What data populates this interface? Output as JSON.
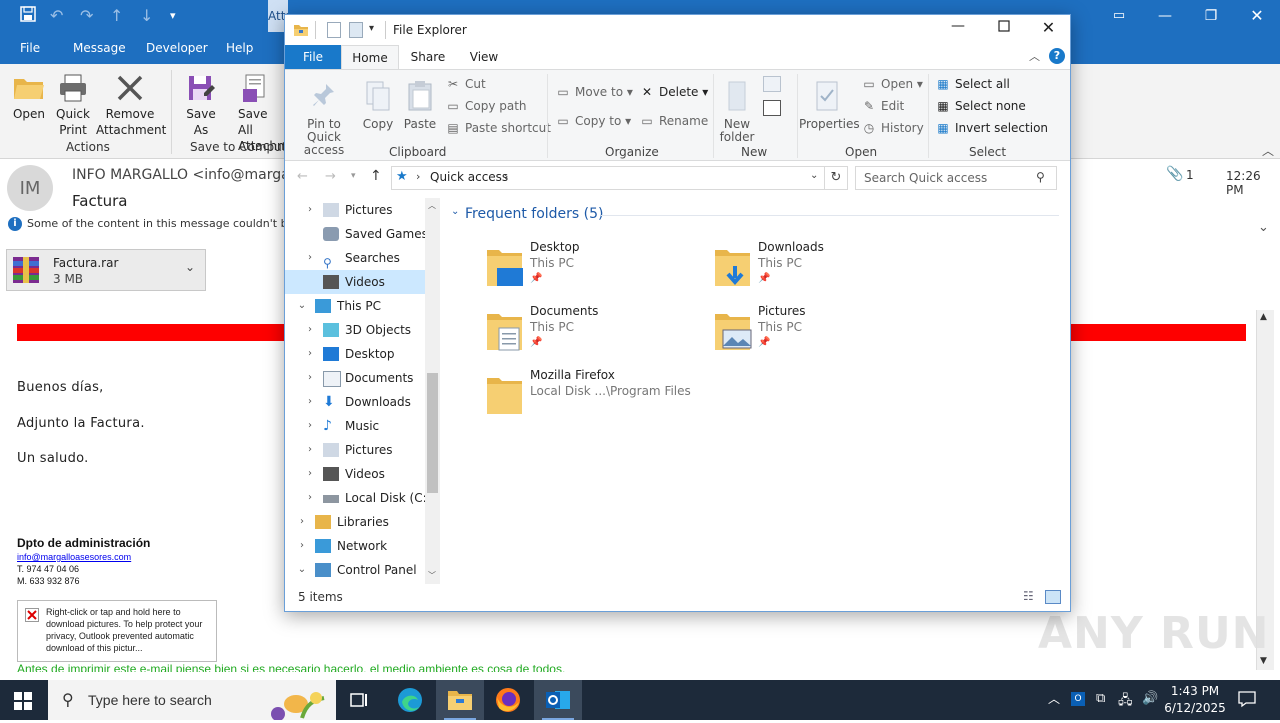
{
  "outlook": {
    "tool_tab_partial": "Attachment Tools",
    "tabs": [
      "File",
      "Message",
      "Developer",
      "Help"
    ],
    "ribbon": {
      "open": "Open",
      "quick_print_1": "Quick",
      "quick_print_2": "Print",
      "remove_1": "Remove",
      "remove_2": "Attachment",
      "save_as_1": "Save",
      "save_as_2": "As",
      "save_all_1": "Save All",
      "save_all_2": "Attachments",
      "group_actions": "Actions",
      "group_save": "Save to Computer"
    },
    "message": {
      "avatar": "IM",
      "from": "INFO MARGALLO <info@margallo",
      "subject": "Factura",
      "infobar": "Some of the content in this message couldn't be displayed.",
      "attachment_count": "1",
      "time": "12:26 PM",
      "attachment_name": "Factura.rar",
      "attachment_size": "3 MB",
      "greeting": "Buenos días,",
      "line1": "Adjunto la Factura.",
      "closing": "Un saludo.",
      "sig_name": "Dpto de administración",
      "sig_email": "info@margalloasesores.com",
      "sig_phone": "T. 974 47 04 06",
      "sig_mobile": "M. 633 932 876",
      "image_placeholder": "Right-click or tap and hold here to download pictures. To help protect your privacy, Outlook prevented automatic download of this pictur...",
      "green_note": "Antes de imprimir este e-mail piense bien si es necesario hacerlo, el medio ambiente es cosa de todos."
    }
  },
  "explorer": {
    "title": "File Explorer",
    "tabs": [
      "File",
      "Home",
      "Share",
      "View"
    ],
    "ribbon": {
      "pin_1": "Pin to Quick",
      "pin_2": "access",
      "copy": "Copy",
      "paste": "Paste",
      "cut": "Cut",
      "copy_path": "Copy path",
      "paste_shortcut": "Paste shortcut",
      "move_to": "Move to",
      "copy_to": "Copy to",
      "delete": "Delete",
      "rename": "Rename",
      "new_folder_1": "New",
      "new_folder_2": "folder",
      "properties": "Properties",
      "open": "Open",
      "edit": "Edit",
      "history": "History",
      "select_all": "Select all",
      "select_none": "Select none",
      "invert_selection": "Invert selection",
      "groups": [
        "Clipboard",
        "Organize",
        "New",
        "Open",
        "Select"
      ]
    },
    "address": "Quick access",
    "search_placeholder": "Search Quick access",
    "tree": [
      {
        "label": "Pictures"
      },
      {
        "label": "Saved Games"
      },
      {
        "label": "Searches"
      },
      {
        "label": "Videos"
      },
      {
        "label": "This PC"
      },
      {
        "label": "3D Objects"
      },
      {
        "label": "Desktop"
      },
      {
        "label": "Documents"
      },
      {
        "label": "Downloads"
      },
      {
        "label": "Music"
      },
      {
        "label": "Pictures"
      },
      {
        "label": "Videos"
      },
      {
        "label": "Local Disk (C:)"
      },
      {
        "label": "Libraries"
      },
      {
        "label": "Network"
      },
      {
        "label": "Control Panel"
      }
    ],
    "section_title": "Frequent folders (5)",
    "folders": [
      {
        "name": "Desktop",
        "path": "This PC"
      },
      {
        "name": "Downloads",
        "path": "This PC"
      },
      {
        "name": "Documents",
        "path": "This PC"
      },
      {
        "name": "Pictures",
        "path": "This PC"
      },
      {
        "name": "Mozilla Firefox",
        "path": "Local Disk ...\\Program Files"
      }
    ],
    "status": "5 items"
  },
  "taskbar": {
    "search_placeholder": "Type here to search",
    "time": "1:43 PM",
    "date": "6/12/2025"
  },
  "watermark": "ANY RUN"
}
